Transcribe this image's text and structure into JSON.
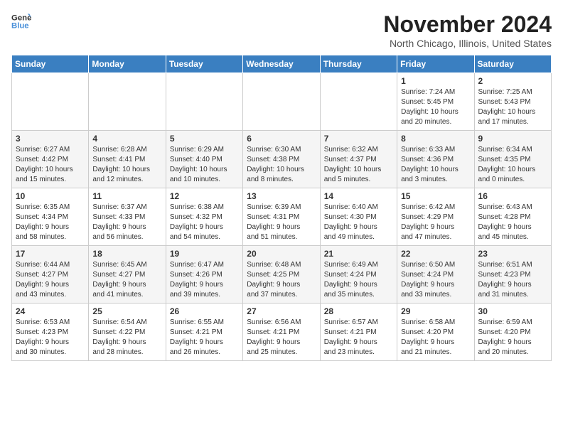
{
  "header": {
    "logo_line1": "General",
    "logo_line2": "Blue",
    "month": "November 2024",
    "location": "North Chicago, Illinois, United States"
  },
  "days_of_week": [
    "Sunday",
    "Monday",
    "Tuesday",
    "Wednesday",
    "Thursday",
    "Friday",
    "Saturday"
  ],
  "weeks": [
    [
      {
        "day": "",
        "info": ""
      },
      {
        "day": "",
        "info": ""
      },
      {
        "day": "",
        "info": ""
      },
      {
        "day": "",
        "info": ""
      },
      {
        "day": "",
        "info": ""
      },
      {
        "day": "1",
        "info": "Sunrise: 7:24 AM\nSunset: 5:45 PM\nDaylight: 10 hours\nand 20 minutes."
      },
      {
        "day": "2",
        "info": "Sunrise: 7:25 AM\nSunset: 5:43 PM\nDaylight: 10 hours\nand 17 minutes."
      }
    ],
    [
      {
        "day": "3",
        "info": "Sunrise: 6:27 AM\nSunset: 4:42 PM\nDaylight: 10 hours\nand 15 minutes."
      },
      {
        "day": "4",
        "info": "Sunrise: 6:28 AM\nSunset: 4:41 PM\nDaylight: 10 hours\nand 12 minutes."
      },
      {
        "day": "5",
        "info": "Sunrise: 6:29 AM\nSunset: 4:40 PM\nDaylight: 10 hours\nand 10 minutes."
      },
      {
        "day": "6",
        "info": "Sunrise: 6:30 AM\nSunset: 4:38 PM\nDaylight: 10 hours\nand 8 minutes."
      },
      {
        "day": "7",
        "info": "Sunrise: 6:32 AM\nSunset: 4:37 PM\nDaylight: 10 hours\nand 5 minutes."
      },
      {
        "day": "8",
        "info": "Sunrise: 6:33 AM\nSunset: 4:36 PM\nDaylight: 10 hours\nand 3 minutes."
      },
      {
        "day": "9",
        "info": "Sunrise: 6:34 AM\nSunset: 4:35 PM\nDaylight: 10 hours\nand 0 minutes."
      }
    ],
    [
      {
        "day": "10",
        "info": "Sunrise: 6:35 AM\nSunset: 4:34 PM\nDaylight: 9 hours\nand 58 minutes."
      },
      {
        "day": "11",
        "info": "Sunrise: 6:37 AM\nSunset: 4:33 PM\nDaylight: 9 hours\nand 56 minutes."
      },
      {
        "day": "12",
        "info": "Sunrise: 6:38 AM\nSunset: 4:32 PM\nDaylight: 9 hours\nand 54 minutes."
      },
      {
        "day": "13",
        "info": "Sunrise: 6:39 AM\nSunset: 4:31 PM\nDaylight: 9 hours\nand 51 minutes."
      },
      {
        "day": "14",
        "info": "Sunrise: 6:40 AM\nSunset: 4:30 PM\nDaylight: 9 hours\nand 49 minutes."
      },
      {
        "day": "15",
        "info": "Sunrise: 6:42 AM\nSunset: 4:29 PM\nDaylight: 9 hours\nand 47 minutes."
      },
      {
        "day": "16",
        "info": "Sunrise: 6:43 AM\nSunset: 4:28 PM\nDaylight: 9 hours\nand 45 minutes."
      }
    ],
    [
      {
        "day": "17",
        "info": "Sunrise: 6:44 AM\nSunset: 4:27 PM\nDaylight: 9 hours\nand 43 minutes."
      },
      {
        "day": "18",
        "info": "Sunrise: 6:45 AM\nSunset: 4:27 PM\nDaylight: 9 hours\nand 41 minutes."
      },
      {
        "day": "19",
        "info": "Sunrise: 6:47 AM\nSunset: 4:26 PM\nDaylight: 9 hours\nand 39 minutes."
      },
      {
        "day": "20",
        "info": "Sunrise: 6:48 AM\nSunset: 4:25 PM\nDaylight: 9 hours\nand 37 minutes."
      },
      {
        "day": "21",
        "info": "Sunrise: 6:49 AM\nSunset: 4:24 PM\nDaylight: 9 hours\nand 35 minutes."
      },
      {
        "day": "22",
        "info": "Sunrise: 6:50 AM\nSunset: 4:24 PM\nDaylight: 9 hours\nand 33 minutes."
      },
      {
        "day": "23",
        "info": "Sunrise: 6:51 AM\nSunset: 4:23 PM\nDaylight: 9 hours\nand 31 minutes."
      }
    ],
    [
      {
        "day": "24",
        "info": "Sunrise: 6:53 AM\nSunset: 4:23 PM\nDaylight: 9 hours\nand 30 minutes."
      },
      {
        "day": "25",
        "info": "Sunrise: 6:54 AM\nSunset: 4:22 PM\nDaylight: 9 hours\nand 28 minutes."
      },
      {
        "day": "26",
        "info": "Sunrise: 6:55 AM\nSunset: 4:21 PM\nDaylight: 9 hours\nand 26 minutes."
      },
      {
        "day": "27",
        "info": "Sunrise: 6:56 AM\nSunset: 4:21 PM\nDaylight: 9 hours\nand 25 minutes."
      },
      {
        "day": "28",
        "info": "Sunrise: 6:57 AM\nSunset: 4:21 PM\nDaylight: 9 hours\nand 23 minutes."
      },
      {
        "day": "29",
        "info": "Sunrise: 6:58 AM\nSunset: 4:20 PM\nDaylight: 9 hours\nand 21 minutes."
      },
      {
        "day": "30",
        "info": "Sunrise: 6:59 AM\nSunset: 4:20 PM\nDaylight: 9 hours\nand 20 minutes."
      }
    ]
  ]
}
